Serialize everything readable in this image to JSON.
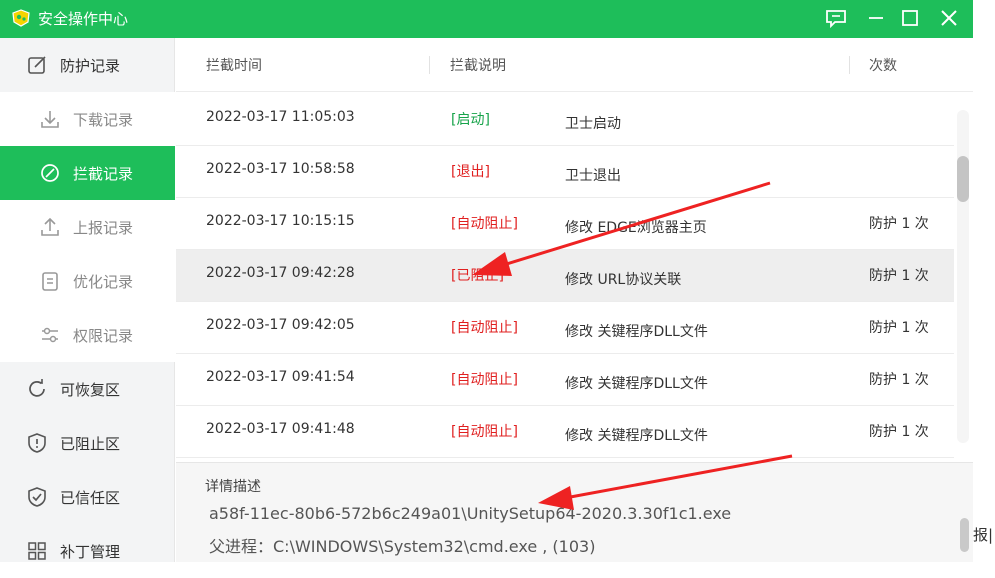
{
  "window": {
    "title": "安全操作中心"
  },
  "colors": {
    "brand_green": "#1ebe5a",
    "tag_green": "#17a34a",
    "tag_red": "#e02020",
    "arrow_red": "#ee2222"
  },
  "titlebar_buttons": [
    "feedback-icon",
    "minimize-icon",
    "maximize-icon",
    "close-icon"
  ],
  "sidebar": {
    "items": [
      {
        "label": "防护记录",
        "icon": "edit-square-icon",
        "kind": "top"
      },
      {
        "label": "下载记录",
        "icon": "download-icon",
        "kind": "sub"
      },
      {
        "label": "拦截记录",
        "icon": "block-circle-icon",
        "kind": "sub",
        "active": true
      },
      {
        "label": "上报记录",
        "icon": "upload-icon",
        "kind": "sub"
      },
      {
        "label": "优化记录",
        "icon": "document-list-icon",
        "kind": "sub"
      },
      {
        "label": "权限记录",
        "icon": "sliders-icon",
        "kind": "sub"
      },
      {
        "label": "可恢复区",
        "icon": "restore-icon",
        "kind": "top"
      },
      {
        "label": "已阻止区",
        "icon": "shield-alert-icon",
        "kind": "top"
      },
      {
        "label": "已信任区",
        "icon": "shield-check-icon",
        "kind": "top"
      },
      {
        "label": "补丁管理",
        "icon": "grid-icon",
        "kind": "top"
      }
    ]
  },
  "table": {
    "columns": [
      "拦截时间",
      "拦截说明",
      "次数"
    ],
    "rows": [
      {
        "time": "2022-03-17 11:05:03",
        "tag": "[启动]",
        "tag_color": "green",
        "desc": "卫士启动",
        "count": ""
      },
      {
        "time": "2022-03-17 10:58:58",
        "tag": "[退出]",
        "tag_color": "red",
        "desc": "卫士退出",
        "count": ""
      },
      {
        "time": "2022-03-17 10:15:15",
        "tag": "[自动阻止]",
        "tag_color": "red",
        "desc": "修改 EDGE浏览器主页",
        "count": "防护 1 次"
      },
      {
        "time": "2022-03-17 09:42:28",
        "tag": "[已阻止]",
        "tag_color": "red",
        "desc": "修改 URL协议关联",
        "count": "防护 1 次",
        "highlighted": true
      },
      {
        "time": "2022-03-17 09:42:05",
        "tag": "[自动阻止]",
        "tag_color": "red",
        "desc": "修改 关键程序DLL文件",
        "count": "防护 1 次"
      },
      {
        "time": "2022-03-17 09:41:54",
        "tag": "[自动阻止]",
        "tag_color": "red",
        "desc": "修改 关键程序DLL文件",
        "count": "防护 1 次"
      },
      {
        "time": "2022-03-17 09:41:48",
        "tag": "[自动阻止]",
        "tag_color": "red",
        "desc": "修改 关键程序DLL文件",
        "count": "防护 1 次"
      }
    ]
  },
  "detail": {
    "title": "详情描述",
    "line1": "a58f-11ec-80b6-572b6c249a01\\UnitySetup64-2020.3.30f1c1.exe",
    "line2": "父进程：C:\\WINDOWS\\System32\\cmd.exe , (103)"
  },
  "background_fragment": {
    "text": "报|"
  }
}
